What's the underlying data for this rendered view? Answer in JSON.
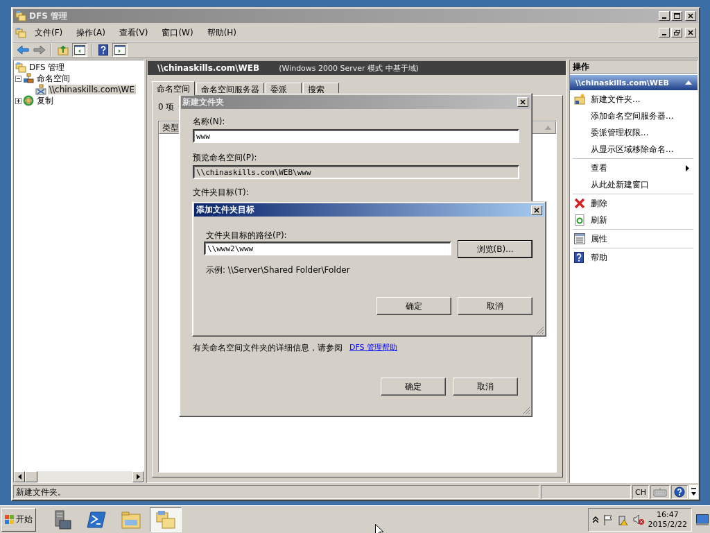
{
  "window": {
    "title": "DFS 管理"
  },
  "menu": [
    "文件(F)",
    "操作(A)",
    "查看(V)",
    "窗口(W)",
    "帮助(H)"
  ],
  "tree": [
    {
      "label": "DFS 管理",
      "kind": "root",
      "selected": false,
      "children": [
        {
          "label": "命名空间",
          "kind": "namespaces",
          "expanded": true,
          "selected": false,
          "children": [
            {
              "label": "\\\\chinaskills.com\\WE",
              "kind": "namespace",
              "selected": true
            }
          ]
        },
        {
          "label": "复制",
          "kind": "replication",
          "expanded": false,
          "selected": false
        }
      ]
    }
  ],
  "center": {
    "header_title": "\\\\chinaskills.com\\WEB",
    "header_mode": "(Windows 2000 Server 模式 中基于域)",
    "tabs": [
      {
        "label": "命名空间",
        "selected": true
      },
      {
        "label": "命名空间服务器",
        "selected": false
      },
      {
        "label": "委派",
        "selected": false
      },
      {
        "label": "搜索",
        "selected": false
      }
    ],
    "item_count": "0 项",
    "columns": [
      "类型"
    ]
  },
  "actions": {
    "title": "操作",
    "section": "\\\\chinaskills.com\\WEB",
    "groups": [
      [
        {
          "label": "新建文件夹...",
          "kind": "new-folder",
          "has_submenu": false
        },
        {
          "label": "添加命名空间服务器...",
          "kind": "plain",
          "has_submenu": false
        },
        {
          "label": "委派管理权限...",
          "kind": "plain",
          "has_submenu": false
        },
        {
          "label": "从显示区域移除命名...",
          "kind": "plain",
          "has_submenu": false
        }
      ],
      [
        {
          "label": "查看",
          "kind": "plain",
          "has_submenu": true
        },
        {
          "label": "从此处新建窗口",
          "kind": "plain",
          "has_submenu": false
        }
      ],
      [
        {
          "label": "删除",
          "kind": "delete",
          "has_submenu": false
        },
        {
          "label": "刷新",
          "kind": "refresh",
          "has_submenu": false
        }
      ],
      [
        {
          "label": "属性",
          "kind": "properties",
          "has_submenu": false
        }
      ],
      [
        {
          "label": "帮助",
          "kind": "help",
          "has_submenu": false
        }
      ]
    ]
  },
  "status_bar": {
    "text": "新建文件夹。",
    "ime": "CH"
  },
  "new_folder_dialog": {
    "title": "新建文件夹",
    "name_label": "名称(N):",
    "name_value": "www",
    "preview_label": "预览命名空间(P):",
    "preview_value": "\\\\chinaskills.com\\WEB\\www",
    "targets_label": "文件夹目标(T):",
    "help_text": "有关命名空间文件夹的详细信息，请参阅",
    "help_link": "DFS 管理帮助",
    "buttons": [
      "确定",
      "取消"
    ]
  },
  "add_target_dialog": {
    "title": "添加文件夹目标",
    "path_label": "文件夹目标的路径(P):",
    "path_value": "\\\\www2\\www",
    "browse": "浏览(B)...",
    "example": "示例: \\\\Server\\Shared Folder\\Folder",
    "buttons": [
      "确定",
      "取消"
    ]
  },
  "taskbar": {
    "start": "开始",
    "apps": [
      {
        "kind": "server-manager",
        "selected": false
      },
      {
        "kind": "powershell",
        "selected": false
      },
      {
        "kind": "explorer",
        "selected": false
      },
      {
        "kind": "dfs",
        "selected": true
      }
    ],
    "time": "16:47",
    "date": "2015/2/22"
  }
}
